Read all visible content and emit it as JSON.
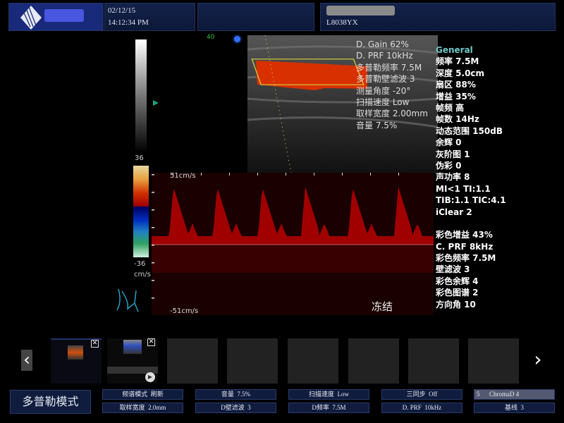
{
  "header": {
    "date": "02/12/15",
    "time": "14:12:34 PM",
    "probe": "L8038YX"
  },
  "image": {
    "depth_marker": "40",
    "gray_top": "36",
    "color_scale_top": "36",
    "color_scale_bottom": "-36",
    "color_scale_unit": "cm/s",
    "velocity_top": "51cm/s",
    "velocity_bottom": "-51cm/s",
    "frozen_label": "冻结"
  },
  "doppler_params": [
    "D. Gain 62%",
    "D. PRF 10kHz",
    "多普勒频率 7.5M",
    "多普勒壁滤波 3",
    "测量角度 -20°",
    "扫描速度 Low",
    "取样宽度 2.00mm",
    "音量 7.5%"
  ],
  "general": {
    "title": "General",
    "items": [
      "频率 7.5M",
      "深度 5.0cm",
      "扇区 88%",
      "增益 35%",
      "帧频 高",
      "帧数 14Hz",
      "动态范围 150dB",
      "余辉 0",
      "灰阶图 1",
      "伪彩 0",
      "声功率 8",
      "MI<1  TI:1.1",
      "TIB:1.1  TIC:4.1",
      "iClear 2"
    ]
  },
  "color": {
    "items": [
      "彩色增益 43%",
      "C. PRF 8kHz",
      "彩色频率 7.5M",
      "壁滤波 3",
      "彩色余辉 4",
      "彩色图谱 2",
      "方向角 10"
    ]
  },
  "colors": {
    "accent": "#1a2a5a",
    "general_title": "#6fc8c8",
    "doppler": "#c00000"
  },
  "bottom": {
    "mode": "多普勒模式",
    "buttons": [
      [
        "频谱模式  刷新",
        "取样宽度  2.0mm"
      ],
      [
        "音量  7.5%",
        "D壁滤波  3"
      ],
      [
        "扫描速度  Low",
        "D频率  7.5M"
      ],
      [
        "三同步  Off",
        "D. PRF  10kHz"
      ],
      [
        "5      ChromaD 4",
        "基线  3"
      ]
    ]
  }
}
